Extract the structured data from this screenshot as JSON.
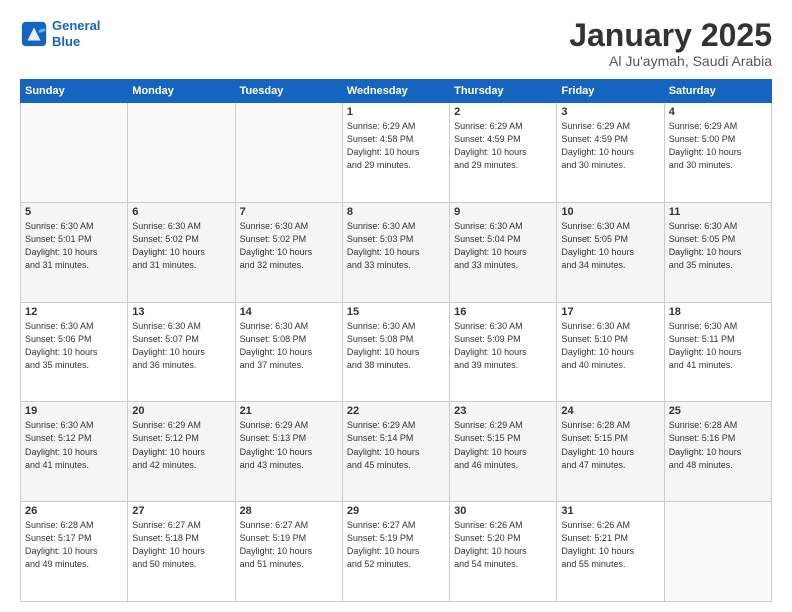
{
  "logo": {
    "line1": "General",
    "line2": "Blue"
  },
  "header": {
    "month": "January 2025",
    "location": "Al Ju'aymah, Saudi Arabia"
  },
  "weekdays": [
    "Sunday",
    "Monday",
    "Tuesday",
    "Wednesday",
    "Thursday",
    "Friday",
    "Saturday"
  ],
  "weeks": [
    [
      {
        "day": "",
        "info": ""
      },
      {
        "day": "",
        "info": ""
      },
      {
        "day": "",
        "info": ""
      },
      {
        "day": "1",
        "info": "Sunrise: 6:29 AM\nSunset: 4:58 PM\nDaylight: 10 hours\nand 29 minutes."
      },
      {
        "day": "2",
        "info": "Sunrise: 6:29 AM\nSunset: 4:59 PM\nDaylight: 10 hours\nand 29 minutes."
      },
      {
        "day": "3",
        "info": "Sunrise: 6:29 AM\nSunset: 4:59 PM\nDaylight: 10 hours\nand 30 minutes."
      },
      {
        "day": "4",
        "info": "Sunrise: 6:29 AM\nSunset: 5:00 PM\nDaylight: 10 hours\nand 30 minutes."
      }
    ],
    [
      {
        "day": "5",
        "info": "Sunrise: 6:30 AM\nSunset: 5:01 PM\nDaylight: 10 hours\nand 31 minutes."
      },
      {
        "day": "6",
        "info": "Sunrise: 6:30 AM\nSunset: 5:02 PM\nDaylight: 10 hours\nand 31 minutes."
      },
      {
        "day": "7",
        "info": "Sunrise: 6:30 AM\nSunset: 5:02 PM\nDaylight: 10 hours\nand 32 minutes."
      },
      {
        "day": "8",
        "info": "Sunrise: 6:30 AM\nSunset: 5:03 PM\nDaylight: 10 hours\nand 33 minutes."
      },
      {
        "day": "9",
        "info": "Sunrise: 6:30 AM\nSunset: 5:04 PM\nDaylight: 10 hours\nand 33 minutes."
      },
      {
        "day": "10",
        "info": "Sunrise: 6:30 AM\nSunset: 5:05 PM\nDaylight: 10 hours\nand 34 minutes."
      },
      {
        "day": "11",
        "info": "Sunrise: 6:30 AM\nSunset: 5:05 PM\nDaylight: 10 hours\nand 35 minutes."
      }
    ],
    [
      {
        "day": "12",
        "info": "Sunrise: 6:30 AM\nSunset: 5:06 PM\nDaylight: 10 hours\nand 35 minutes."
      },
      {
        "day": "13",
        "info": "Sunrise: 6:30 AM\nSunset: 5:07 PM\nDaylight: 10 hours\nand 36 minutes."
      },
      {
        "day": "14",
        "info": "Sunrise: 6:30 AM\nSunset: 5:08 PM\nDaylight: 10 hours\nand 37 minutes."
      },
      {
        "day": "15",
        "info": "Sunrise: 6:30 AM\nSunset: 5:08 PM\nDaylight: 10 hours\nand 38 minutes."
      },
      {
        "day": "16",
        "info": "Sunrise: 6:30 AM\nSunset: 5:09 PM\nDaylight: 10 hours\nand 39 minutes."
      },
      {
        "day": "17",
        "info": "Sunrise: 6:30 AM\nSunset: 5:10 PM\nDaylight: 10 hours\nand 40 minutes."
      },
      {
        "day": "18",
        "info": "Sunrise: 6:30 AM\nSunset: 5:11 PM\nDaylight: 10 hours\nand 41 minutes."
      }
    ],
    [
      {
        "day": "19",
        "info": "Sunrise: 6:30 AM\nSunset: 5:12 PM\nDaylight: 10 hours\nand 41 minutes."
      },
      {
        "day": "20",
        "info": "Sunrise: 6:29 AM\nSunset: 5:12 PM\nDaylight: 10 hours\nand 42 minutes."
      },
      {
        "day": "21",
        "info": "Sunrise: 6:29 AM\nSunset: 5:13 PM\nDaylight: 10 hours\nand 43 minutes."
      },
      {
        "day": "22",
        "info": "Sunrise: 6:29 AM\nSunset: 5:14 PM\nDaylight: 10 hours\nand 45 minutes."
      },
      {
        "day": "23",
        "info": "Sunrise: 6:29 AM\nSunset: 5:15 PM\nDaylight: 10 hours\nand 46 minutes."
      },
      {
        "day": "24",
        "info": "Sunrise: 6:28 AM\nSunset: 5:15 PM\nDaylight: 10 hours\nand 47 minutes."
      },
      {
        "day": "25",
        "info": "Sunrise: 6:28 AM\nSunset: 5:16 PM\nDaylight: 10 hours\nand 48 minutes."
      }
    ],
    [
      {
        "day": "26",
        "info": "Sunrise: 6:28 AM\nSunset: 5:17 PM\nDaylight: 10 hours\nand 49 minutes."
      },
      {
        "day": "27",
        "info": "Sunrise: 6:27 AM\nSunset: 5:18 PM\nDaylight: 10 hours\nand 50 minutes."
      },
      {
        "day": "28",
        "info": "Sunrise: 6:27 AM\nSunset: 5:19 PM\nDaylight: 10 hours\nand 51 minutes."
      },
      {
        "day": "29",
        "info": "Sunrise: 6:27 AM\nSunset: 5:19 PM\nDaylight: 10 hours\nand 52 minutes."
      },
      {
        "day": "30",
        "info": "Sunrise: 6:26 AM\nSunset: 5:20 PM\nDaylight: 10 hours\nand 54 minutes."
      },
      {
        "day": "31",
        "info": "Sunrise: 6:26 AM\nSunset: 5:21 PM\nDaylight: 10 hours\nand 55 minutes."
      },
      {
        "day": "",
        "info": ""
      }
    ]
  ]
}
